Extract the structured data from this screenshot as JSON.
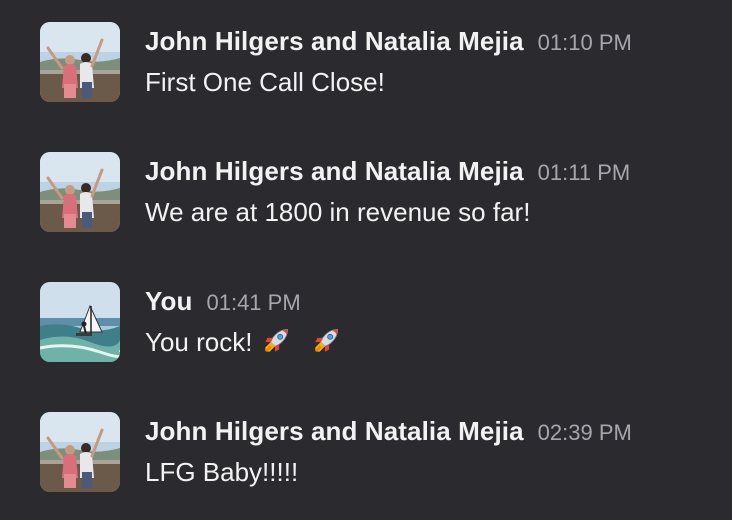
{
  "messages": [
    {
      "sender": "John Hilgers and Natalia Mejia",
      "time": "01:10 PM",
      "text": "First One Call Close!",
      "avatar": "couple-photo-avatar"
    },
    {
      "sender": "John Hilgers and Natalia Mejia",
      "time": "01:11 PM",
      "text": "We are at 1800 in revenue so far!",
      "avatar": "couple-photo-avatar"
    },
    {
      "sender": "You",
      "time": "01:41 PM",
      "text": "You rock!",
      "emoji": [
        "rocket-icon",
        "rocket-icon"
      ],
      "avatar": "windsurf-photo-avatar"
    },
    {
      "sender": "John Hilgers and Natalia Mejia",
      "time": "02:39 PM",
      "text": "LFG Baby!!!!!",
      "avatar": "couple-photo-avatar"
    }
  ],
  "colors": {
    "background": "#2a2a2f",
    "text": "#f2f2f2",
    "timestamp": "#a6a6ad"
  }
}
